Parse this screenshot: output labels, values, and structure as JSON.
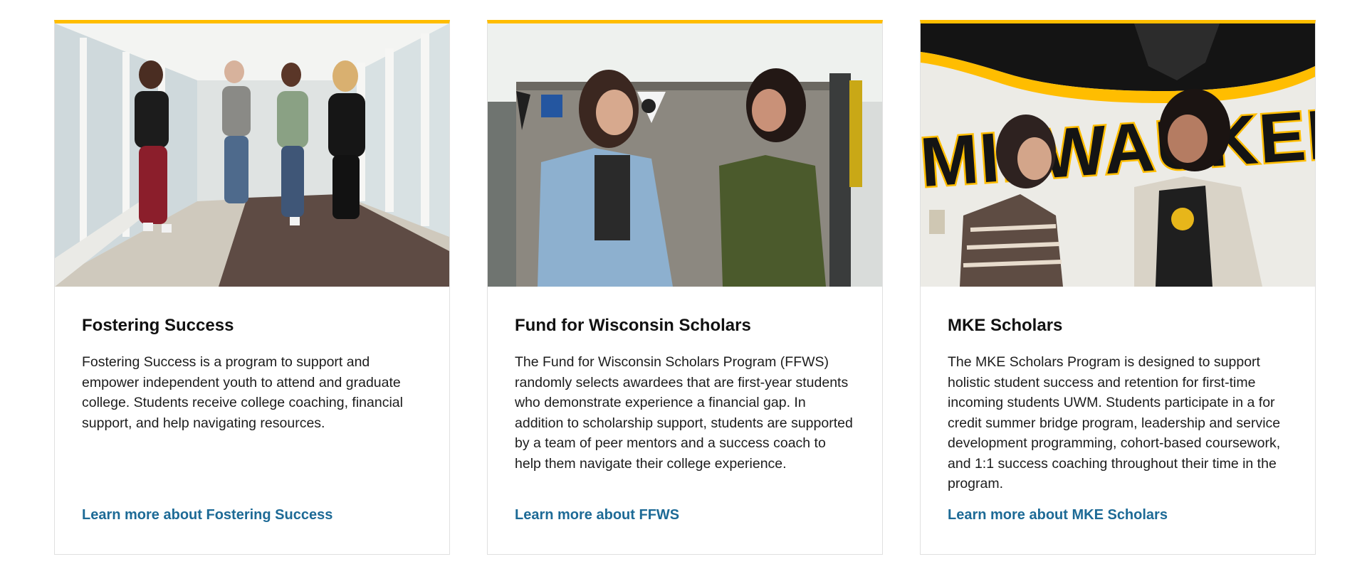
{
  "colors": {
    "accent": "#ffbd00",
    "link": "#1d6a96",
    "border": "#e0e0e0"
  },
  "cards": [
    {
      "image": "photo-students-walking-hallway",
      "title": "Fostering Success",
      "body": "Fostering Success is a program to support and empower independent youth to attend and graduate college. Students receive college coaching, financial support, and help navigating resources.",
      "link": "Learn more about Fostering Success"
    },
    {
      "image": "photo-students-talking-by-cubicle",
      "title": "Fund for Wisconsin Scholars",
      "body": "The Fund for Wisconsin Scholars Program (FFWS) randomly selects awardees that are first-year students who demonstrate experience a financial gap. In addition to scholarship support, students are supported by a team of peer mentors and a success coach to help them navigate their college experience.",
      "link": "Learn more about FFWS"
    },
    {
      "image": "photo-students-by-milwaukee-mural",
      "title": "MKE Scholars",
      "body": "The MKE Scholars Program is designed to support holistic student success and retention for first-time incoming students UWM. Students participate in a for credit summer bridge program, leadership and service development programming, cohort-based coursework, and 1:1 success coaching throughout their time in the program.",
      "link": "Learn more about MKE Scholars",
      "mural_text": "MILWAUKEE"
    }
  ]
}
